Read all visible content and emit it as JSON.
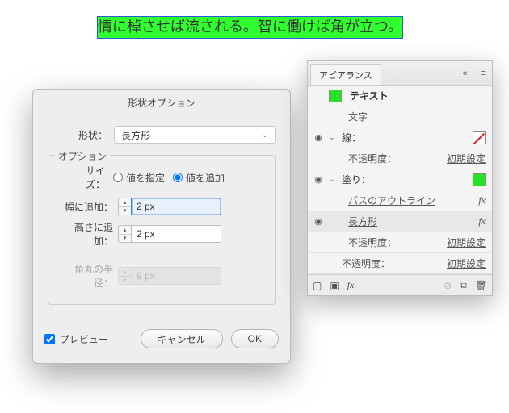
{
  "artboard_text": "情に棹させば流される。智に働けば角が立つ。",
  "dialog": {
    "title": "形状オプション",
    "shape_label": "形状：",
    "shape_value": "長方形",
    "options_legend": "オプション",
    "size_label": "サイズ：",
    "size_radio_specify": "値を指定",
    "size_radio_add": "値を追加",
    "width_label": "幅に追加：",
    "width_value": "2 px",
    "height_label": "高さに追加：",
    "height_value": "2 px",
    "corner_label": "角丸の半径：",
    "corner_value": "9 px",
    "preview_label": "プレビュー",
    "cancel_label": "キャンセル",
    "ok_label": "OK"
  },
  "panel": {
    "tab": "アピアランス",
    "target_type": "テキスト",
    "characters": "文字",
    "stroke": "線：",
    "fill": "塗り：",
    "outline_path": "パスのアウトライン",
    "rectangle": "長方形",
    "opacity_label": "不透明度：",
    "opacity_value": "初期設定",
    "swatch_green": "#25e425"
  }
}
